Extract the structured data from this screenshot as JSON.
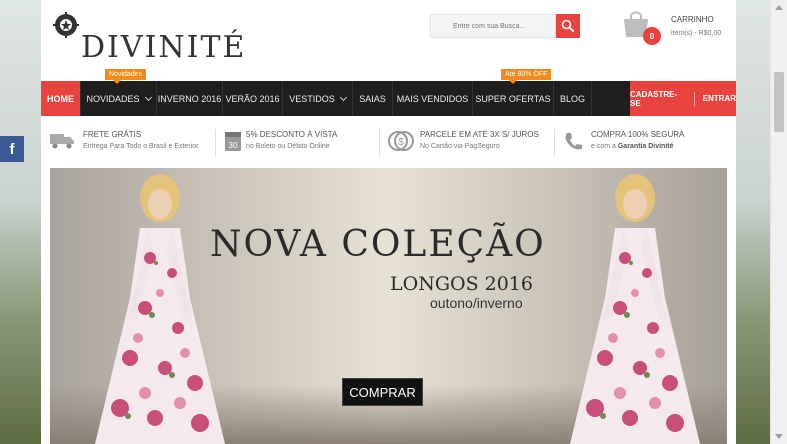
{
  "brand": {
    "name": "DIVINITÉ",
    "accent": "#e8433e",
    "orange": "#f28a1d",
    "nav_bg": "#1e1e1e"
  },
  "search": {
    "placeholder": "Entre com sua Busca..."
  },
  "cart": {
    "label": "CARRINHO",
    "count": "0",
    "info": "item(s) - R$0,00"
  },
  "nav": {
    "items": [
      {
        "label": "HOME"
      },
      {
        "label": "NOVIDADES",
        "tag": "Novidades"
      },
      {
        "label": "INVERNO 2016"
      },
      {
        "label": "VERÃO 2016"
      },
      {
        "label": "VESTIDOS"
      },
      {
        "label": "SAIAS"
      },
      {
        "label": "MAIS VENDIDOS"
      },
      {
        "label": "SUPER OFERTAS",
        "tag": "Até 80% OFF"
      },
      {
        "label": "BLOG"
      }
    ],
    "signup": "CADASTRE-SE",
    "login": "ENTRAR"
  },
  "benefits": [
    {
      "icon": "truck-icon",
      "title": "FRETE GRÁTIS",
      "sub": "Entrega Para Todo o Brasil e Exterior"
    },
    {
      "icon": "calendar-30-icon",
      "title": "5% DESCONTO À VISTA",
      "sub": "no Boleto ou Débito Online"
    },
    {
      "icon": "coins-icon",
      "title": "PARCELE EM ATÉ 3X S/ JUROS",
      "sub": "No Cartão via PagSeguro"
    },
    {
      "icon": "phone-icon",
      "title": "COMPRA 100% SEGURA",
      "sub_prefix": "e com a ",
      "sub_bold": "Garantia Divinité"
    }
  ],
  "banner": {
    "title": "NOVA COLEÇÃO",
    "subtitle": "LONGOS 2016",
    "season": "outono/inverno",
    "button": "COMPRAR"
  },
  "social": {
    "facebook": "f"
  }
}
